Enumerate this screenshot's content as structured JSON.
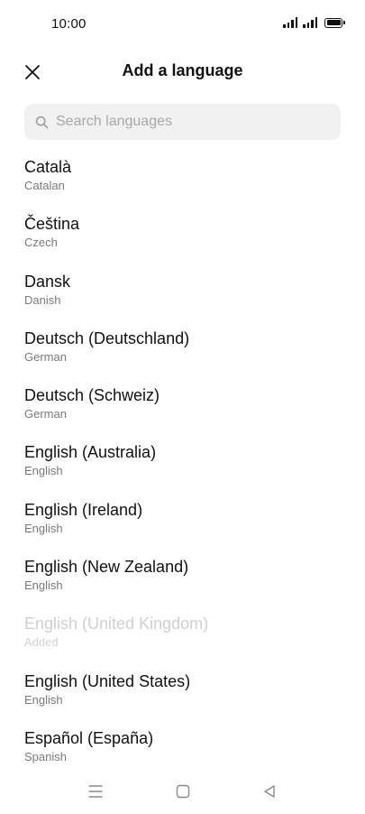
{
  "status_bar": {
    "time": "10:00"
  },
  "header": {
    "title": "Add a language",
    "close_icon": "close-icon"
  },
  "search": {
    "placeholder": "Search languages",
    "value": "",
    "icon": "search-icon"
  },
  "languages": [
    {
      "name": "Català",
      "subtitle": "Catalan",
      "disabled": false
    },
    {
      "name": "Čeština",
      "subtitle": "Czech",
      "disabled": false
    },
    {
      "name": "Dansk",
      "subtitle": "Danish",
      "disabled": false
    },
    {
      "name": "Deutsch (Deutschland)",
      "subtitle": "German",
      "disabled": false
    },
    {
      "name": "Deutsch (Schweiz)",
      "subtitle": "German",
      "disabled": false
    },
    {
      "name": "English (Australia)",
      "subtitle": "English",
      "disabled": false
    },
    {
      "name": "English (Ireland)",
      "subtitle": "English",
      "disabled": false
    },
    {
      "name": "English (New Zealand)",
      "subtitle": "English",
      "disabled": false
    },
    {
      "name": "English (United Kingdom)",
      "subtitle": "Added",
      "disabled": true
    },
    {
      "name": "English (United States)",
      "subtitle": "English",
      "disabled": false
    },
    {
      "name": "Español (España)",
      "subtitle": "Spanish",
      "disabled": false
    }
  ],
  "nav_bar": {
    "icons": [
      "menu-icon",
      "home-icon",
      "back-icon"
    ]
  },
  "colors": {
    "text_primary": "#111111",
    "text_secondary": "#7a7a7a",
    "text_disabled": "#cfcfcf",
    "search_background": "#f1f1f1",
    "background": "#ffffff"
  }
}
